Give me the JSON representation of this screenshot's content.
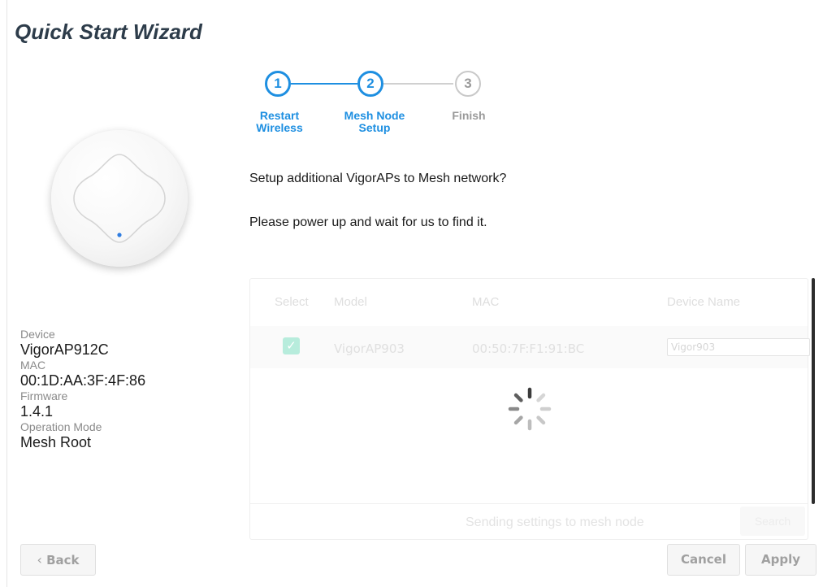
{
  "page": {
    "title": "Quick Start Wizard"
  },
  "device": {
    "device_label": "Device",
    "device_value": "VigorAP912C",
    "mac_label": "MAC",
    "mac_value": "00:1D:AA:3F:4F:86",
    "firmware_label": "Firmware",
    "firmware_value": "1.4.1",
    "mode_label": "Operation Mode",
    "mode_value": "Mesh Root"
  },
  "steps": [
    {
      "number": "1",
      "label_line1": "Restart",
      "label_line2": "Wireless",
      "state": "done"
    },
    {
      "number": "2",
      "label_line1": "Mesh Node",
      "label_line2": "Setup",
      "state": "active"
    },
    {
      "number": "3",
      "label_line1": "Finish",
      "label_line2": "",
      "state": "inactive"
    }
  ],
  "messages": {
    "question": "Setup additional VigorAPs to Mesh network?",
    "instruction": "Please power up and wait for us to find it."
  },
  "table": {
    "headers": [
      "Select",
      "Model",
      "MAC",
      "Device Name"
    ],
    "rows": [
      {
        "selected": true,
        "model": "VigorAP903",
        "mac": "00:50:7F:F1:91:BC",
        "device_name": "Vigor903"
      }
    ],
    "status": "Sending settings to mesh node",
    "search_label": "Search"
  },
  "buttons": {
    "back": "Back",
    "cancel": "Cancel",
    "apply": "Apply"
  },
  "colors": {
    "accent": "#1e8fe1",
    "title": "#2d3c4a",
    "inactive": "#9a9a9a",
    "check": "#b7ecdc"
  }
}
